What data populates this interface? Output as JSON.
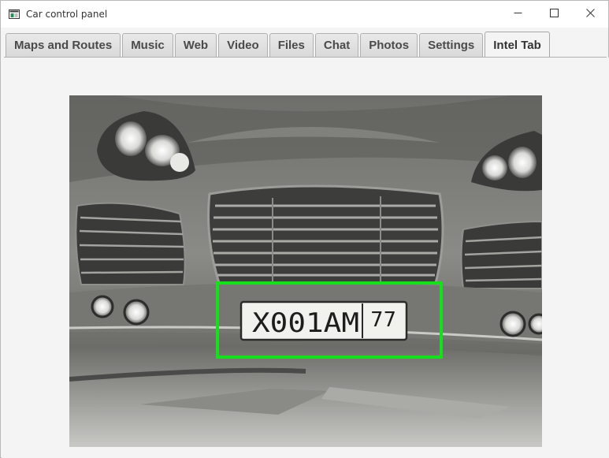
{
  "window": {
    "title": "Car control panel",
    "controls": {
      "minimize_icon": "minimize-icon",
      "maximize_icon": "maximize-icon",
      "close_icon": "close-icon"
    }
  },
  "tabs": [
    {
      "label": "Maps and Routes",
      "selected": false
    },
    {
      "label": "Music",
      "selected": false
    },
    {
      "label": "Web",
      "selected": false
    },
    {
      "label": "Video",
      "selected": false
    },
    {
      "label": "Files",
      "selected": false
    },
    {
      "label": "Chat",
      "selected": false
    },
    {
      "label": "Photos",
      "selected": false
    },
    {
      "label": "Settings",
      "selected": false
    },
    {
      "label": "Intel Tab",
      "selected": true
    }
  ],
  "camera": {
    "plate_text": "X001AM",
    "plate_region": "77",
    "detection_box_color": "#16e01b"
  },
  "colors": {
    "window_bg": "#f4f4f4",
    "titlebar_bg": "#ffffff",
    "tab_text": "#4a4a4a"
  }
}
